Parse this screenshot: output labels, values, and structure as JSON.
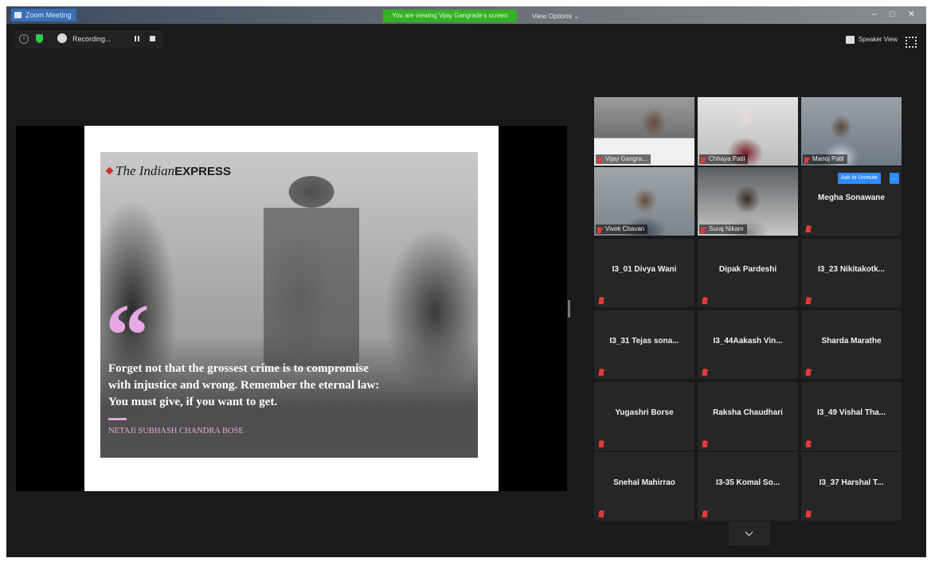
{
  "window": {
    "app_title": "Zoom Meeting",
    "viewing_banner": "You are viewing Vijay Gangrade's screen",
    "view_options": "View Options ⌄",
    "controls": [
      "–",
      "□",
      "✕"
    ]
  },
  "recording": {
    "label": "Recording..."
  },
  "speaker_view": {
    "label": "Speaker View"
  },
  "slide": {
    "logo_name": "The Indian",
    "logo_express": "EXPRESS",
    "quote_mark": "“",
    "quote_lines": [
      "Forget not that the grossest crime is to compromise",
      "with injustice and wrong. Remember the eternal law:",
      "You must give, if you want to get."
    ],
    "author": "NETAJI SUBHASH CHANDRA BOSE"
  },
  "gallery": {
    "video_tiles": [
      {
        "name": "Vijay Gangra..."
      },
      {
        "name": "Chhaya Patil"
      },
      {
        "name": "Manoj Patil"
      },
      {
        "name": "Vivek Chavan"
      },
      {
        "name": "Suraj Nikam"
      }
    ],
    "megha": {
      "name": "Megha Sonawane",
      "ask_unmute": "Ask to Unmute",
      "more": "..."
    },
    "name_tiles": [
      "I3_01 Divya Wani",
      "Dipak Pardeshi",
      "I3_23 Nikitakotk...",
      "I3_31 Tejas sona...",
      "I3_44Aakash Vin...",
      "Sharda Marathe",
      "Yugashri Borse",
      "Raksha Chaudhari",
      "I3_49 Vishal Tha...",
      "Snehal Mahirrao",
      "I3-35 Komal So...",
      "I3_37 Harshal T..."
    ]
  },
  "colors": {
    "accent": "#2d8cff",
    "active_speaker": "#c8e34a",
    "banner": "#34b124",
    "muted": "#e23b3b",
    "quote": "#e6a8e3"
  }
}
